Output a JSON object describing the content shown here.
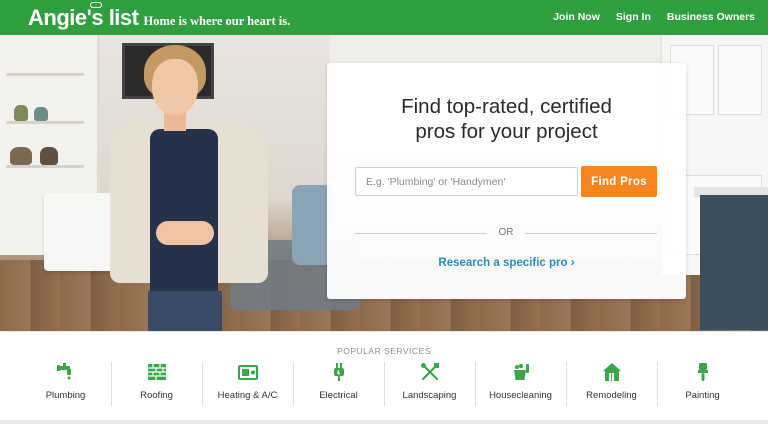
{
  "brand": {
    "logo": "Angie's list",
    "tagline": "Home is where our heart is."
  },
  "nav": {
    "items": [
      "Join Now",
      "Sign In",
      "Business Owners"
    ]
  },
  "hero": {
    "title_line1": "Find top-rated, certified",
    "title_line2": "pros for your project",
    "search": {
      "placeholder": "E.g. 'Plumbing' or 'Handymen'",
      "value": ""
    },
    "find_button": "Find Pros",
    "or_label": "OR",
    "research_link": "Research a specific pro ›"
  },
  "popular_services": {
    "title": "POPULAR SERVICES",
    "items": [
      {
        "label": "Plumbing",
        "icon": "faucet-icon"
      },
      {
        "label": "Roofing",
        "icon": "roof-tiles-icon"
      },
      {
        "label": "Heating & A/C",
        "icon": "hvac-unit-icon"
      },
      {
        "label": "Electrical",
        "icon": "plug-icon"
      },
      {
        "label": "Landscaping",
        "icon": "garden-tools-icon"
      },
      {
        "label": "Housecleaning",
        "icon": "cleaning-bucket-icon"
      },
      {
        "label": "Remodeling",
        "icon": "house-icon"
      },
      {
        "label": "Painting",
        "icon": "paintbrush-icon"
      }
    ]
  },
  "colors": {
    "brand_green": "#2f9e3f",
    "accent_orange": "#f5851f",
    "link_blue": "#2a8ab8"
  }
}
